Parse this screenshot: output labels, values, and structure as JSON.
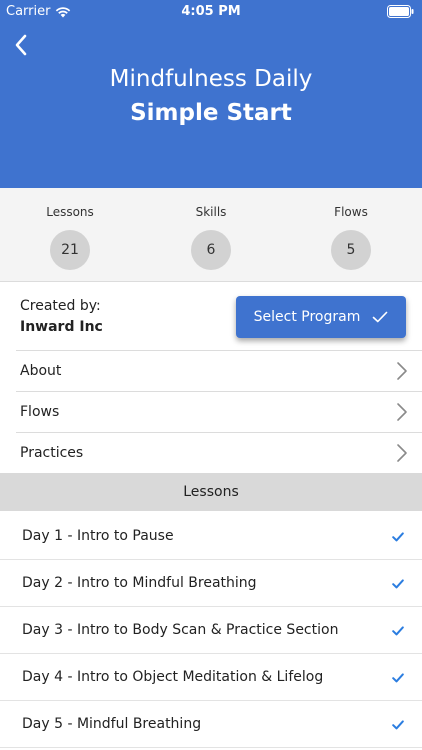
{
  "status_bar": {
    "carrier": "Carrier",
    "time": "4:05 PM"
  },
  "header": {
    "title": "Mindfulness Daily",
    "subtitle": "Simple Start",
    "background_color": "#3f73cf"
  },
  "stats": [
    {
      "label": "Lessons",
      "value": "21"
    },
    {
      "label": "Skills",
      "value": "6"
    },
    {
      "label": "Flows",
      "value": "5"
    }
  ],
  "creator": {
    "label": "Created by:",
    "name": "Inward Inc"
  },
  "select_button": {
    "label": "Select Program",
    "icon": "checkmark-icon"
  },
  "nav": [
    {
      "label": "About",
      "icon": "chevron-right-icon"
    },
    {
      "label": "Flows",
      "icon": "chevron-right-icon"
    },
    {
      "label": "Practices",
      "icon": "chevron-right-icon"
    }
  ],
  "lessons_header": "Lessons",
  "lessons": [
    {
      "label": "Day 1 - Intro to Pause",
      "completed": true
    },
    {
      "label": "Day 2 - Intro to Mindful Breathing",
      "completed": true
    },
    {
      "label": "Day 3 - Intro to Body Scan & Practice Section",
      "completed": true
    },
    {
      "label": "Day 4 - Intro to Object Meditation & Lifelog",
      "completed": true
    },
    {
      "label": "Day 5 - Mindful Breathing",
      "completed": true
    }
  ],
  "colors": {
    "accent": "#3f73cf",
    "check": "#2b7de0"
  }
}
